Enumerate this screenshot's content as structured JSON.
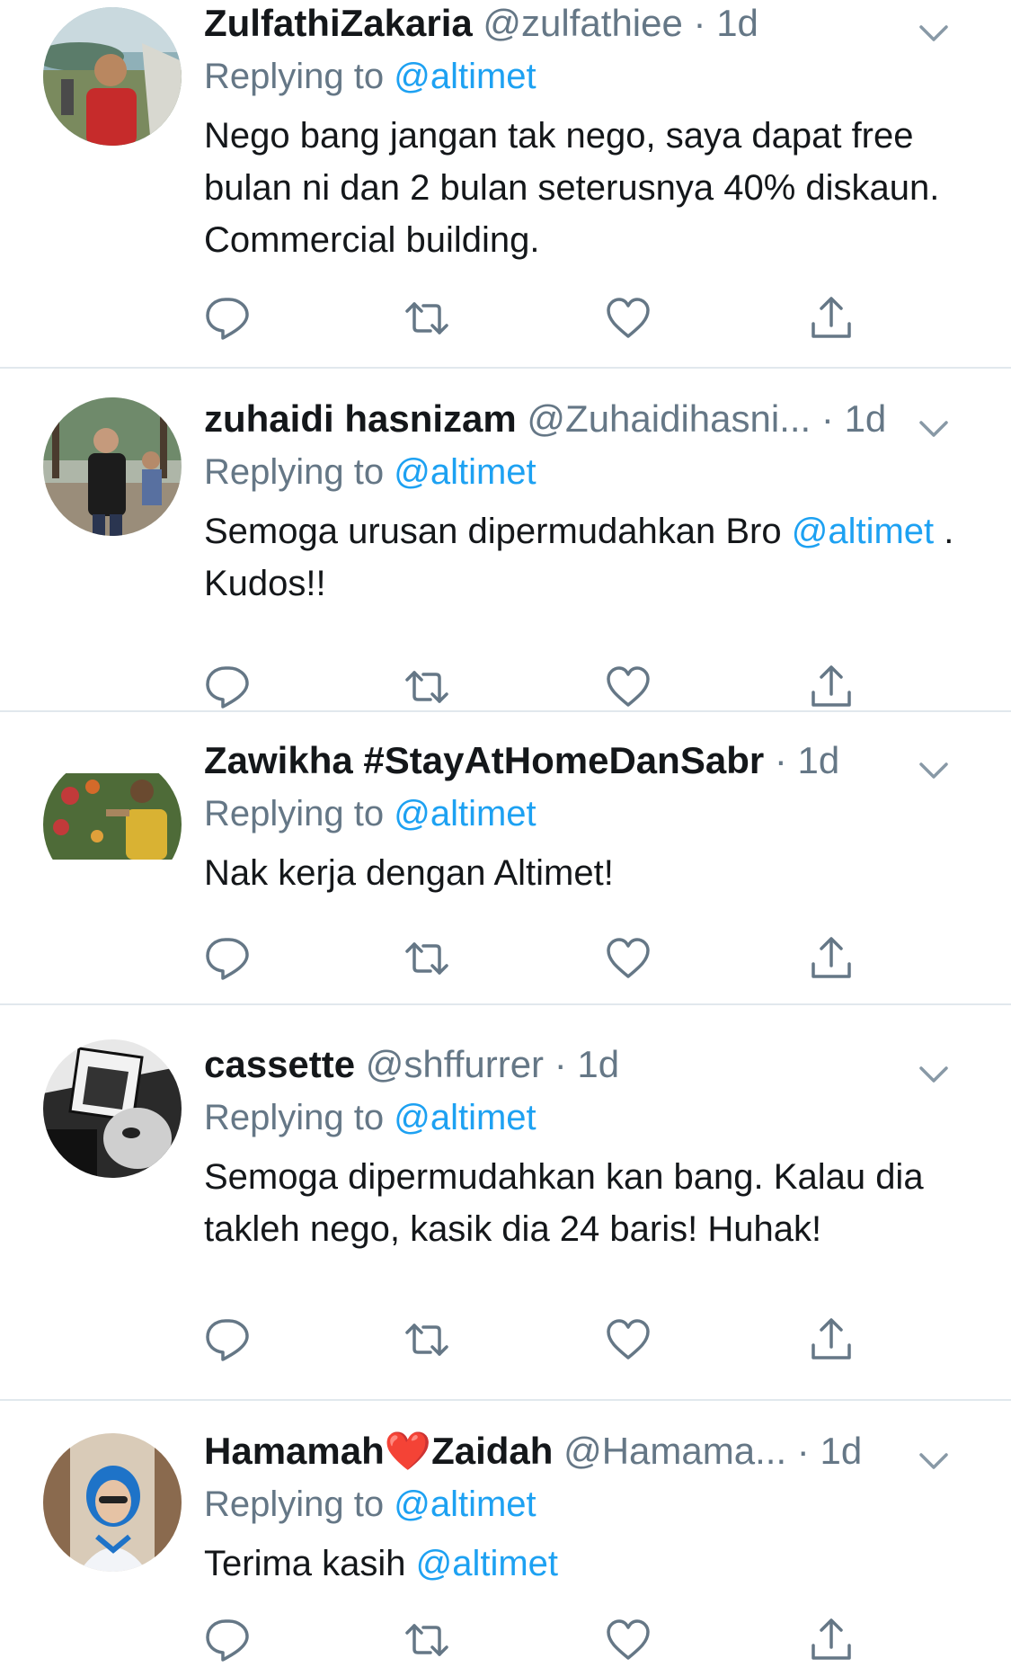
{
  "tweets": [
    {
      "name": "ZulfathiZakaria",
      "handle": "@zulfathiee",
      "dot": "·",
      "time": "1d",
      "replying_prefix": "Replying to ",
      "replying_to": "@altimet",
      "text": "Nego bang jangan tak nego, saya dapat free bulan ni dan 2 bulan seterusnya 40% diskaun. Commercial building."
    },
    {
      "name": "zuhaidi hasnizam",
      "handle": "@Zuhaidihasni...",
      "dot": "·",
      "time": "1d",
      "replying_prefix": "Replying to ",
      "replying_to": "@altimet",
      "text_before": "Semoga urusan dipermudahkan Bro ",
      "text_mention": "@altimet",
      "text_after": " . Kudos!!"
    },
    {
      "name": "Zawikha #StayAtHomeDanSabr",
      "dot": "·",
      "time": "1d",
      "replying_prefix": "Replying to ",
      "replying_to": "@altimet",
      "text": "Nak kerja dengan Altimet!"
    },
    {
      "name": "cassette",
      "handle": "@shffurrer",
      "dot": "·",
      "time": "1d",
      "replying_prefix": "Replying to ",
      "replying_to": "@altimet",
      "text": "Semoga dipermudahkan kan bang. Kalau dia takleh nego, kasik dia 24 baris! Huhak!"
    },
    {
      "name_first": "Hamamah",
      "name_emoji": "❤️",
      "name_last": "Zaidah",
      "handle": "@Hamama...",
      "dot": "·",
      "time": "1d",
      "replying_prefix": "Replying to ",
      "replying_to": "@altimet",
      "text_before": "Terima kasih ",
      "text_mention": "@altimet"
    }
  ],
  "icons": {
    "reply": "reply-icon",
    "retweet": "retweet-icon",
    "like": "heart-icon",
    "share": "share-icon",
    "more": "chevron-down-icon"
  },
  "colors": {
    "link": "#1da1f2",
    "secondary": "#657786",
    "text": "#14171a",
    "divider": "#e1e8ed",
    "heart": "#e0245e"
  }
}
